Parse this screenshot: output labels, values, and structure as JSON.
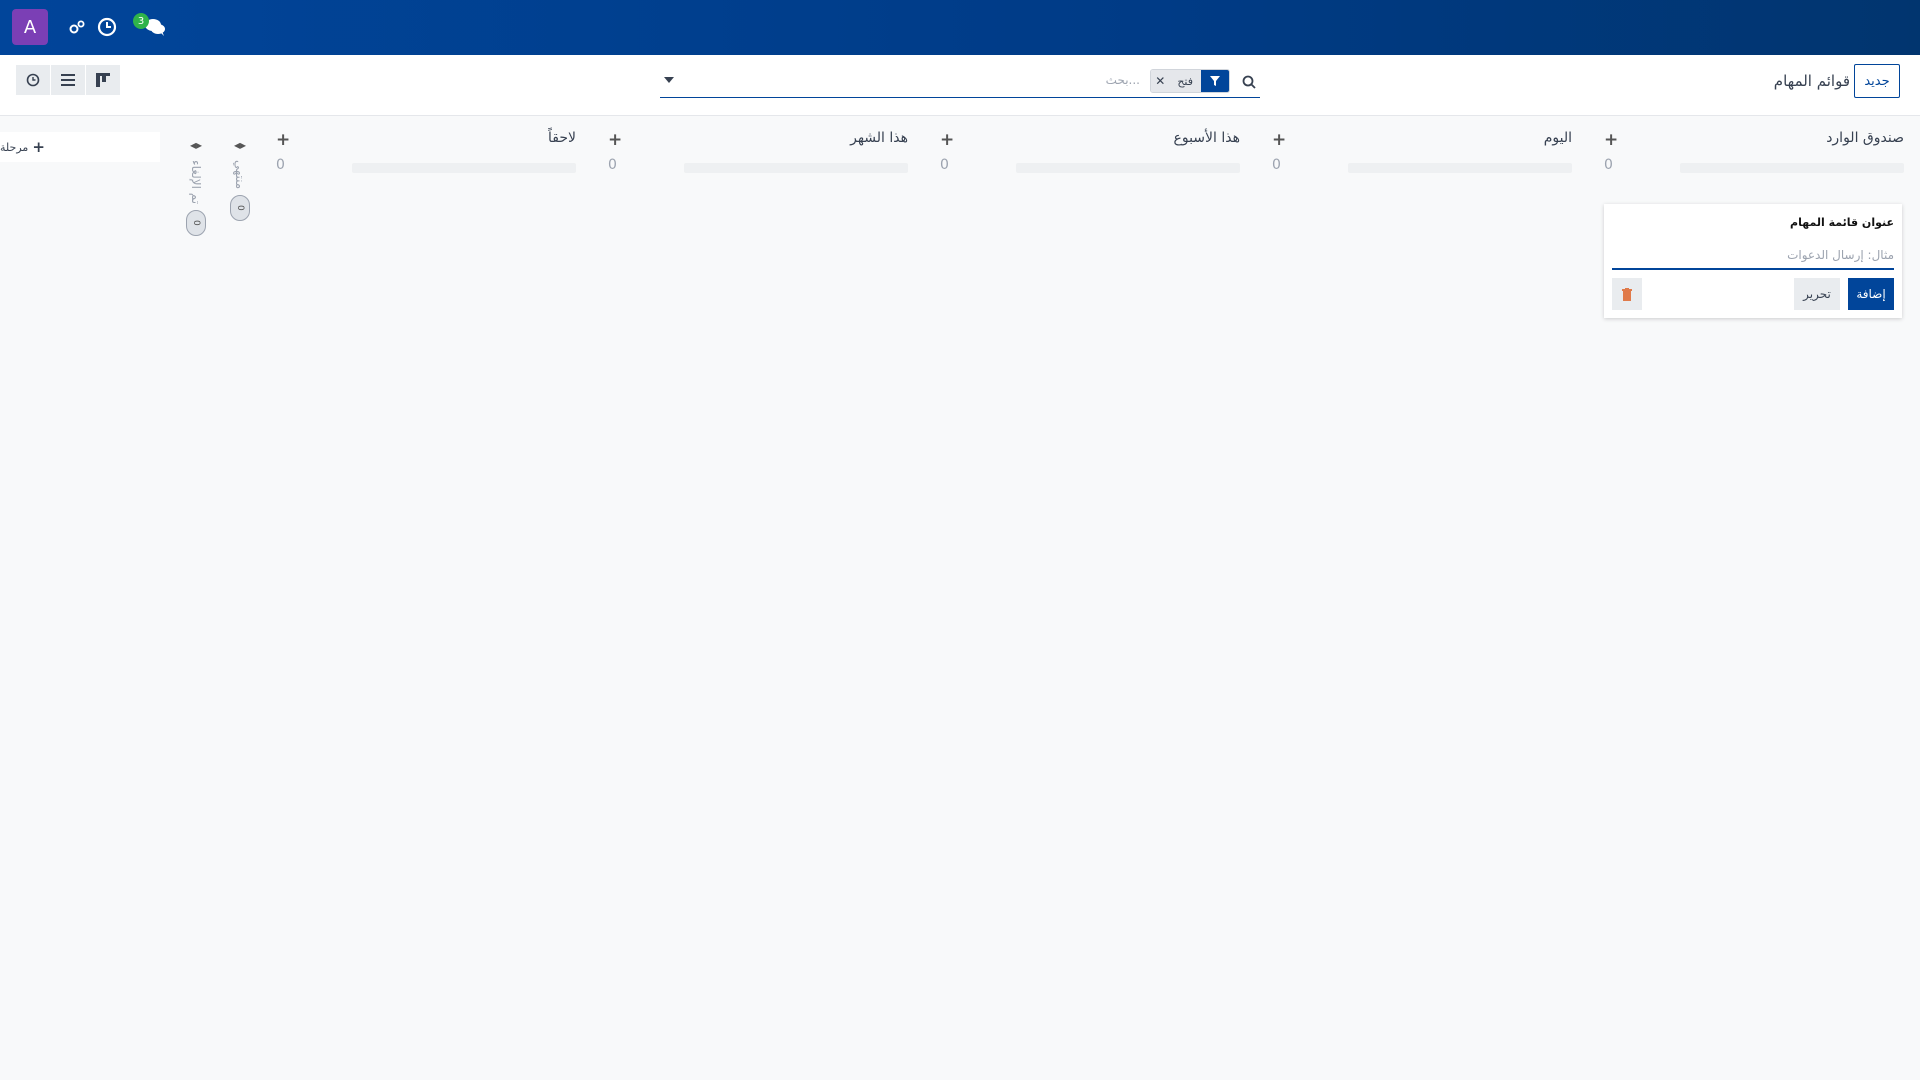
{
  "topbar": {
    "avatar_letter": "A",
    "icons": [
      "settings-gears-icon",
      "clock-icon",
      "chat-icon"
    ],
    "messages_badge": "3"
  },
  "control": {
    "new_button": "جديد",
    "breadcrumb": "قوائم المهام",
    "search": {
      "placeholder": "بحث...",
      "facet_value": "فتح"
    },
    "views": [
      "activity-view-icon",
      "list-view-icon",
      "kanban-view-icon"
    ]
  },
  "columns": [
    {
      "title": "صندوق الوارد",
      "count": "0"
    },
    {
      "title": "اليوم",
      "count": "0"
    },
    {
      "title": "هذا الأسبوع",
      "count": "0"
    },
    {
      "title": "هذا الشهر",
      "count": "0"
    },
    {
      "title": "لاحقاً",
      "count": "0"
    }
  ],
  "folded_columns": [
    {
      "label": "منتهي",
      "count": "0"
    },
    {
      "label": "تم الإلغاء",
      "count": "0"
    }
  ],
  "add_stage_label": "مرحلة",
  "quick_create": {
    "label": "عنوان قائمة المهام",
    "placeholder": "مثال: إرسال الدعوات",
    "add_button": "إضافة",
    "edit_button": "تحرير"
  }
}
